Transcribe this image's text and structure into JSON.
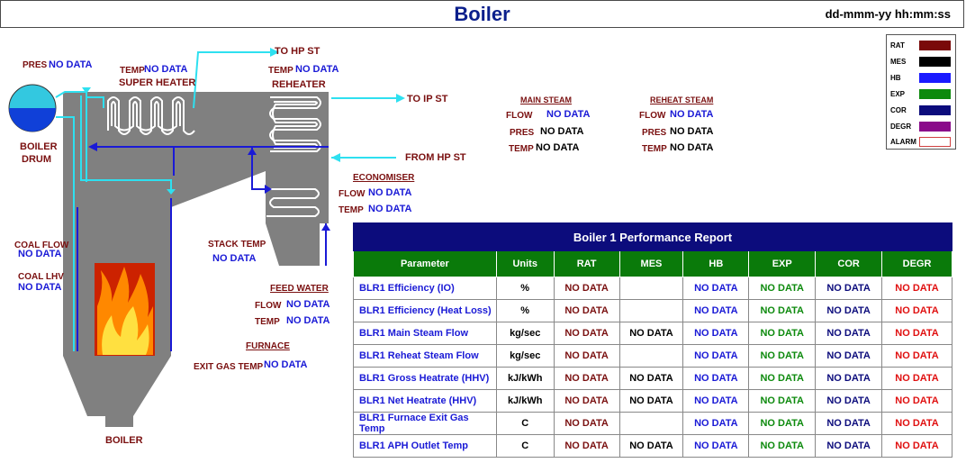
{
  "header": {
    "title": "Boiler",
    "datetime": "dd-mmm-yy hh:mm:ss"
  },
  "drum": {
    "pres_label": "PRES",
    "pres_value": "NO DATA",
    "name_line1": "BOILER",
    "name_line2": "DRUM"
  },
  "superheater": {
    "temp_label": "TEMP",
    "temp_value": "NO DATA",
    "name": "SUPER HEATER"
  },
  "reheater": {
    "temp_label": "TEMP",
    "temp_value": "NO DATA",
    "name": "REHEATER"
  },
  "flows": {
    "to_hp": "TO HP ST",
    "to_ip": "TO IP ST",
    "from_hp": "FROM HP ST"
  },
  "economiser": {
    "title": "ECONOMISER",
    "flow_label": "FLOW",
    "flow_value": "NO DATA",
    "temp_label": "TEMP",
    "temp_value": "NO DATA"
  },
  "coal": {
    "flow_label": "COAL FLOW",
    "flow_value": "NO DATA",
    "lhv_label": "COAL LHV",
    "lhv_value": "NO DATA"
  },
  "stack": {
    "label": "STACK TEMP",
    "value": "NO DATA"
  },
  "feedwater": {
    "title": "FEED WATER",
    "flow_label": "FLOW",
    "flow_value": "NO DATA",
    "temp_label": "TEMP",
    "temp_value": "NO DATA"
  },
  "furnace": {
    "title": "FURNACE",
    "exit_label": "EXIT GAS TEMP",
    "exit_value": "NO DATA"
  },
  "boiler_label": "BOILER",
  "main_steam": {
    "title": "MAIN STEAM",
    "flow_label": "FLOW",
    "flow_value": "NO DATA",
    "pres_label": "PRES",
    "pres_value": "NO DATA",
    "temp_label": "TEMP",
    "temp_value": "NO DATA"
  },
  "reheat_steam": {
    "title": "REHEAT STEAM",
    "flow_label": "FLOW",
    "flow_value": "NO DATA",
    "pres_label": "PRES",
    "pres_value": "NO DATA",
    "temp_label": "TEMP",
    "temp_value": "NO DATA"
  },
  "legend": [
    {
      "label": "RAT",
      "color": "#7a0a0a"
    },
    {
      "label": "MES",
      "color": "#000000"
    },
    {
      "label": "HB",
      "color": "#1a1aff"
    },
    {
      "label": "EXP",
      "color": "#0d8a0d"
    },
    {
      "label": "COR",
      "color": "#0c0c7c"
    },
    {
      "label": "DEGR",
      "color": "#8a0a8a"
    },
    {
      "label": "ALARM",
      "color": "#ffffff"
    }
  ],
  "report": {
    "title": "Boiler 1 Performance Report",
    "columns": [
      "Parameter",
      "Units",
      "RAT",
      "MES",
      "HB",
      "EXP",
      "COR",
      "DEGR"
    ],
    "rows": [
      {
        "param": "BLR1 Efficiency (IO)",
        "unit": "%",
        "rat": "NO DATA",
        "mes": "",
        "hb": "NO DATA",
        "exp": "NO DATA",
        "cor": "NO DATA",
        "degr": "NO DATA"
      },
      {
        "param": "BLR1 Efficiency (Heat Loss)",
        "unit": "%",
        "rat": "NO DATA",
        "mes": "",
        "hb": "NO DATA",
        "exp": "NO DATA",
        "cor": "NO DATA",
        "degr": "NO DATA"
      },
      {
        "param": "BLR1 Main Steam Flow",
        "unit": "kg/sec",
        "rat": "NO DATA",
        "mes": "NO DATA",
        "hb": "NO DATA",
        "exp": "NO DATA",
        "cor": "NO DATA",
        "degr": "NO DATA"
      },
      {
        "param": "BLR1 Reheat Steam Flow",
        "unit": "kg/sec",
        "rat": "NO DATA",
        "mes": "",
        "hb": "NO DATA",
        "exp": "NO DATA",
        "cor": "NO DATA",
        "degr": "NO DATA"
      },
      {
        "param": "BLR1 Gross Heatrate (HHV)",
        "unit": "kJ/kWh",
        "rat": "NO DATA",
        "mes": "NO DATA",
        "hb": "NO DATA",
        "exp": "NO DATA",
        "cor": "NO DATA",
        "degr": "NO DATA"
      },
      {
        "param": "BLR1 Net Heatrate (HHV)",
        "unit": "kJ/kWh",
        "rat": "NO DATA",
        "mes": "NO DATA",
        "hb": "NO DATA",
        "exp": "NO DATA",
        "cor": "NO DATA",
        "degr": "NO DATA"
      },
      {
        "param": "BLR1 Furnace Exit Gas Temp",
        "unit": "C",
        "rat": "NO DATA",
        "mes": "",
        "hb": "NO DATA",
        "exp": "NO DATA",
        "cor": "NO DATA",
        "degr": "NO DATA"
      },
      {
        "param": "BLR1 APH Outlet Temp",
        "unit": "C",
        "rat": "NO DATA",
        "mes": "NO DATA",
        "hb": "NO DATA",
        "exp": "NO DATA",
        "cor": "NO DATA",
        "degr": "NO DATA"
      }
    ]
  }
}
